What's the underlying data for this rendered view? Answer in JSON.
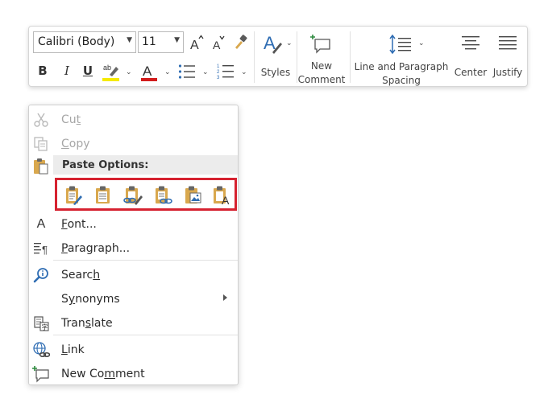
{
  "toolbar": {
    "font_name": "Calibri (Body)",
    "font_size": "11",
    "bold": "B",
    "italic": "I",
    "underline": "U",
    "styles_label": "Styles",
    "new_comment_line1": "New",
    "new_comment_line2": "Comment",
    "line_spacing_line1": "Line and Paragraph",
    "line_spacing_line2": "Spacing",
    "center_label": "Center",
    "justify_label": "Justify",
    "highlight_color": "#f5ea00",
    "font_color": "#d21c1c"
  },
  "menu": {
    "cut_pre": "Cu",
    "cut_u": "t",
    "cut_post": "",
    "copy_pre": "",
    "copy_u": "C",
    "copy_post": "opy",
    "paste_header": "Paste Options:",
    "font_pre": "",
    "font_u": "F",
    "font_post": "ont...",
    "paragraph_pre": "",
    "paragraph_u": "P",
    "paragraph_post": "aragraph...",
    "search_pre": "Searc",
    "search_u": "h",
    "search_post": "",
    "synonyms_pre": "S",
    "synonyms_u": "y",
    "synonyms_post": "nonyms",
    "translate_pre": "Tran",
    "translate_u": "s",
    "translate_post": "late",
    "link_pre": "",
    "link_u": "L",
    "link_post": "ink",
    "newcomment_pre": "New Co",
    "newcomment_u": "m",
    "newcomment_post": "ment"
  },
  "colors": {
    "paste_border": "#d62230",
    "clipboard": "#d9a84e",
    "accent_blue": "#2f6db3"
  }
}
